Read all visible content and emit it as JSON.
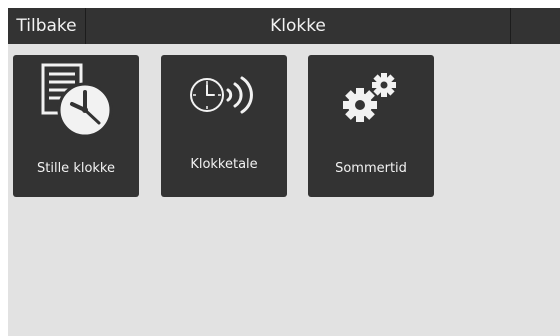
{
  "header": {
    "back_label": "Tilbake",
    "title": "Klokke"
  },
  "tiles": [
    {
      "label": "Stille klokke",
      "icon": "document-clock-icon"
    },
    {
      "label": "Klokketale",
      "icon": "speaking-clock-icon"
    },
    {
      "label": "Sommertid",
      "icon": "gears-icon"
    }
  ],
  "colors": {
    "background": "#e2e2e2",
    "bar": "#333333",
    "tile": "#333333",
    "text": "#f2f2f2"
  }
}
